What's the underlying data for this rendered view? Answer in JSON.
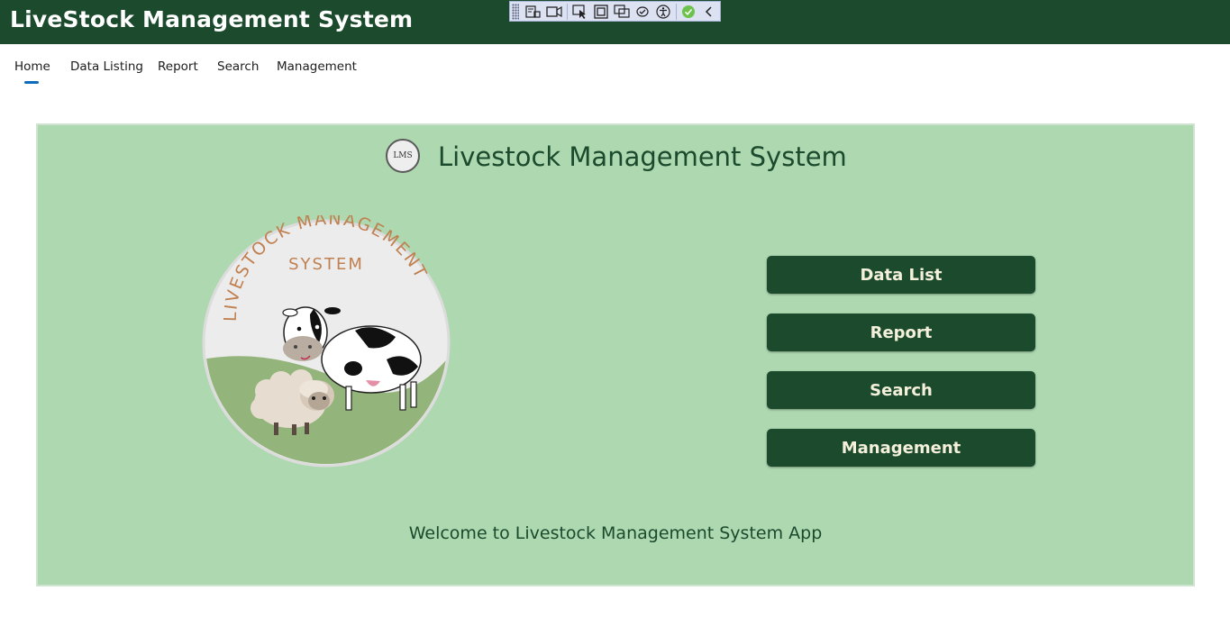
{
  "app": {
    "title": "LiveStock Management System"
  },
  "nav": {
    "items": [
      {
        "label": "Home",
        "active": true
      },
      {
        "label": "Data Listing",
        "active": false
      },
      {
        "label": "Report",
        "active": false
      },
      {
        "label": "Search",
        "active": false
      },
      {
        "label": "Management",
        "active": false
      }
    ]
  },
  "debug_toolbar": {
    "icons": [
      "grip-icon",
      "live-visual-tree-icon",
      "record-icon",
      "select-element-icon",
      "display-layout-adorners-icon",
      "track-focus-icon",
      "binding-failures-icon",
      "accessibility-icon",
      "check-icon",
      "collapse-icon"
    ]
  },
  "home": {
    "badge_text": "LMS",
    "title": "Livestock Management System",
    "logo": {
      "arc_text": "LIVESTOCK MANAGEMENT",
      "sub_text": "SYSTEM"
    },
    "buttons": {
      "data_list": "Data List",
      "report": "Report",
      "search": "Search",
      "management": "Management"
    },
    "welcome": "Welcome to Livestock Management System App"
  },
  "colors": {
    "header_bg": "#1b4a2c",
    "panel_bg": "#add8b0",
    "button_bg": "#1b4a2c",
    "button_text": "#f4f0dc",
    "nav_accent": "#0f6cbd"
  }
}
